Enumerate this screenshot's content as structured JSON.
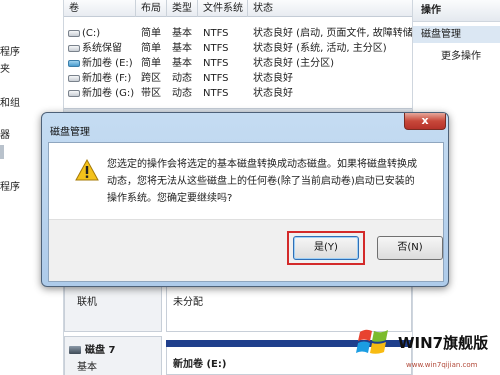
{
  "left_pane": {
    "fragments": [
      "程序",
      "夹",
      "和组",
      "器",
      "程序"
    ]
  },
  "volume_table": {
    "headers": [
      "卷",
      "布局",
      "类型",
      "文件系统",
      "状态"
    ],
    "rows": [
      {
        "volume": "(C:)",
        "layout": "简单",
        "type": "基本",
        "fs": "NTFS",
        "status": "状态良好 (启动, 页面文件, 故障转储",
        "icon": "drive-gray"
      },
      {
        "volume": "系统保留",
        "layout": "简单",
        "type": "基本",
        "fs": "NTFS",
        "status": "状态良好 (系统, 活动, 主分区)",
        "icon": "drive-gray"
      },
      {
        "volume": "新加卷 (E:)",
        "layout": "简单",
        "type": "基本",
        "fs": "NTFS",
        "status": "状态良好 (主分区)",
        "icon": "drive-blue"
      },
      {
        "volume": "新加卷 (F:)",
        "layout": "跨区",
        "type": "动态",
        "fs": "NTFS",
        "status": "状态良好",
        "icon": "drive-gray"
      },
      {
        "volume": "新加卷 (G:)",
        "layout": "带区",
        "type": "动态",
        "fs": "NTFS",
        "status": "状态良好",
        "icon": "drive-gray"
      }
    ]
  },
  "disk_area": {
    "upper_disk_status": "联机",
    "upper_partition_status": "未分配",
    "lower_disk_name": "磁盘 7",
    "lower_disk_type": "基本",
    "lower_partition_name": "新加卷 (E:)"
  },
  "actions": {
    "header": "操作",
    "sub": "磁盘管理",
    "more": "更多操作"
  },
  "watermark": {
    "text": "WIN7旗舰版",
    "url": "www.win7qijian.com"
  },
  "dialog": {
    "title": "磁盘管理",
    "close_glyph": "x",
    "message_lines": [
      "您选定的操作会将选定的基本磁盘转换成动态磁盘。如果将磁盘转换成",
      "动态，您将无法从这些磁盘上的任何卷(除了当前启动卷)启动已安装的",
      "操作系统。您确定要继续吗?"
    ],
    "yes_label": "是(Y)",
    "no_label": "否(N)",
    "icon": "warning-icon"
  },
  "colors": {
    "dialog_frame": "#aecbea",
    "highlight": "#d32a2a",
    "partition_bar": "#1f3f8c"
  }
}
